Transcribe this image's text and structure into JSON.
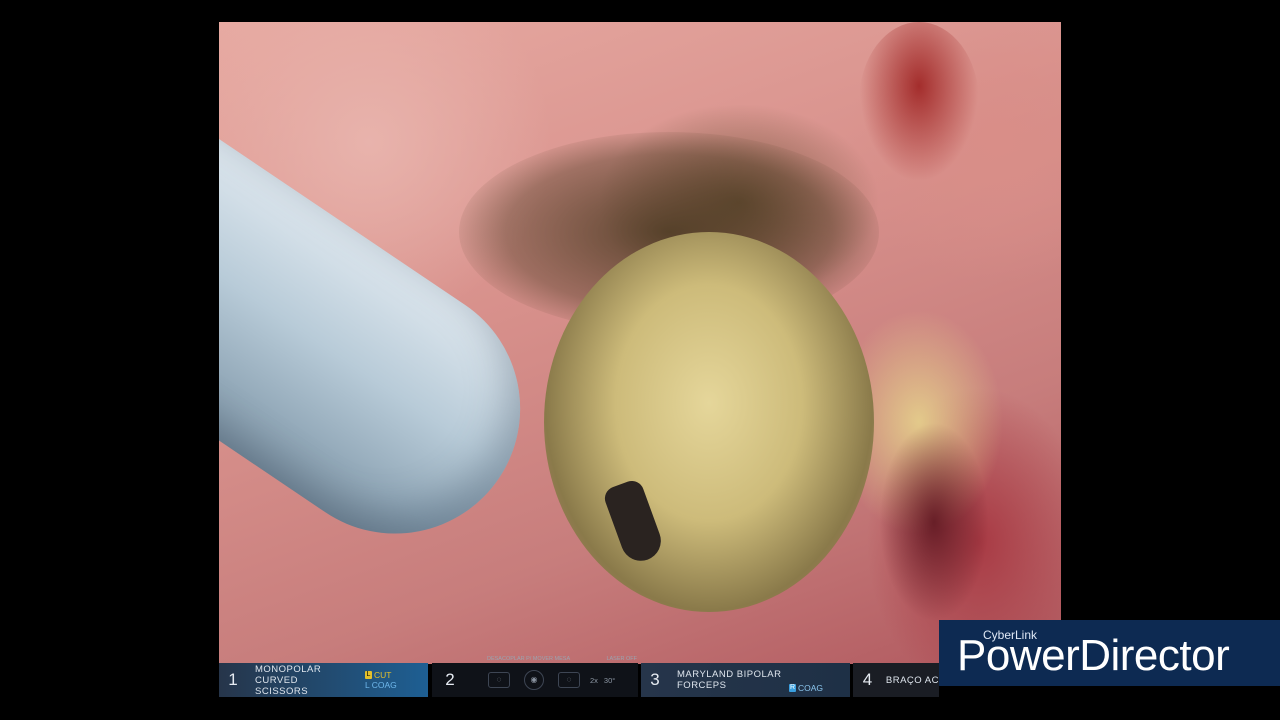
{
  "hud": {
    "slot1": {
      "number": "1",
      "label_line1": "MONOPOLAR CURVED",
      "label_line2": "SCISSORS",
      "mode1": "CUT",
      "mode1_key": "L",
      "mode2": "COAG",
      "mode2_key": "L",
      "mode1_color": "#e3c02b",
      "mode2_color": "#3aa0e0"
    },
    "slot2": {
      "number": "2",
      "top_left": "DESACOPLAR P/ MOVER MESA",
      "top_right": "LASER OFF",
      "zoom": "2x",
      "angle": "30°"
    },
    "slot3": {
      "number": "3",
      "label_line1": "MARYLAND BIPOLAR",
      "label_line2": "FORCEPS",
      "mode1_key": "R",
      "mode1": "COAG",
      "mode1_color": "#3aa0e0"
    },
    "slot4": {
      "number": "4",
      "label": "BRAÇO AC"
    }
  },
  "watermark": {
    "brand_small": "CyberLink",
    "brand_big": "PowerDirector"
  }
}
